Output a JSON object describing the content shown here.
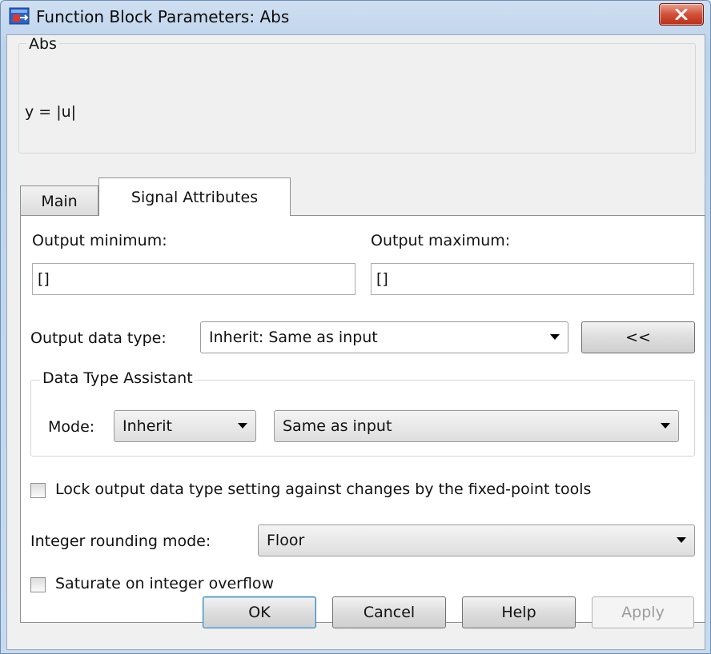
{
  "window": {
    "title": "Function Block Parameters: Abs",
    "close_label": "×"
  },
  "description": {
    "block_name": "Abs",
    "equation": "y = |u|"
  },
  "tabs": [
    {
      "label": "Main",
      "active": false
    },
    {
      "label": "Signal Attributes",
      "active": true
    }
  ],
  "signal_attributes": {
    "output_minimum_label": "Output minimum:",
    "output_minimum_value": "[]",
    "output_maximum_label": "Output maximum:",
    "output_maximum_value": "[]",
    "output_data_type_label": "Output data type:",
    "output_data_type_value": "Inherit: Same as input",
    "assistant_toggle_label": "<<",
    "data_type_assistant": {
      "title": "Data Type Assistant",
      "mode_label": "Mode:",
      "mode_value": "Inherit",
      "inherit_rule_value": "Same as input"
    },
    "lock_label": "Lock output data type setting against changes by the fixed-point tools",
    "lock_checked": false,
    "rounding_label": "Integer rounding mode:",
    "rounding_value": "Floor",
    "saturate_label": "Saturate on integer overflow",
    "saturate_checked": false
  },
  "buttons": {
    "ok": "OK",
    "cancel": "Cancel",
    "help": "Help",
    "apply": "Apply"
  },
  "colors": {
    "title_bar": "#c3d7ee",
    "close_button": "#c8432b",
    "default_button_border": "#3c7fb1"
  }
}
